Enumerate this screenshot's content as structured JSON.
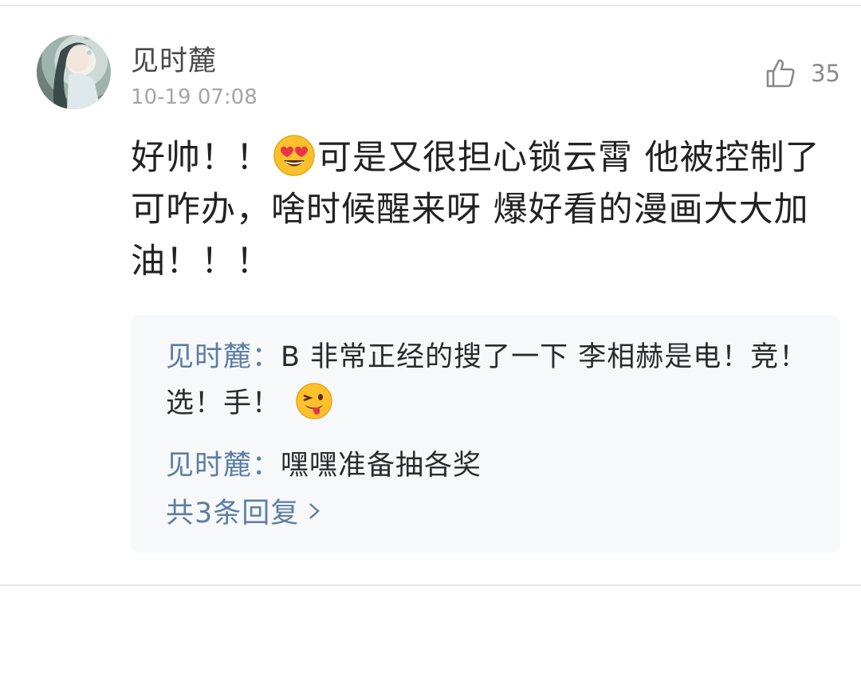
{
  "comment": {
    "username": "见时麓",
    "timestamp": "10-19 07:08",
    "likes": "35",
    "text_part1": "好帅！！",
    "text_part2": "可是又很担心锁云霄 他被控制了可咋办，啥时候醒来呀 爆好看的漫画大大加油！！！",
    "emoji": "heart-eyes-emoji"
  },
  "replies": {
    "items": [
      {
        "name": "见时麓：",
        "text": "B 非常正经的搜了一下 李相赫是电！竞！选！手！",
        "emoji": "winking-tongue-emoji"
      },
      {
        "name": "见时麓：",
        "text": "嘿嘿准备抽各奖"
      }
    ],
    "more_label": "共3条回复"
  },
  "colors": {
    "link": "#5c7ea3",
    "text": "#222222",
    "meta": "#a5a5a5",
    "reply_bg": "#f6f8fa"
  }
}
